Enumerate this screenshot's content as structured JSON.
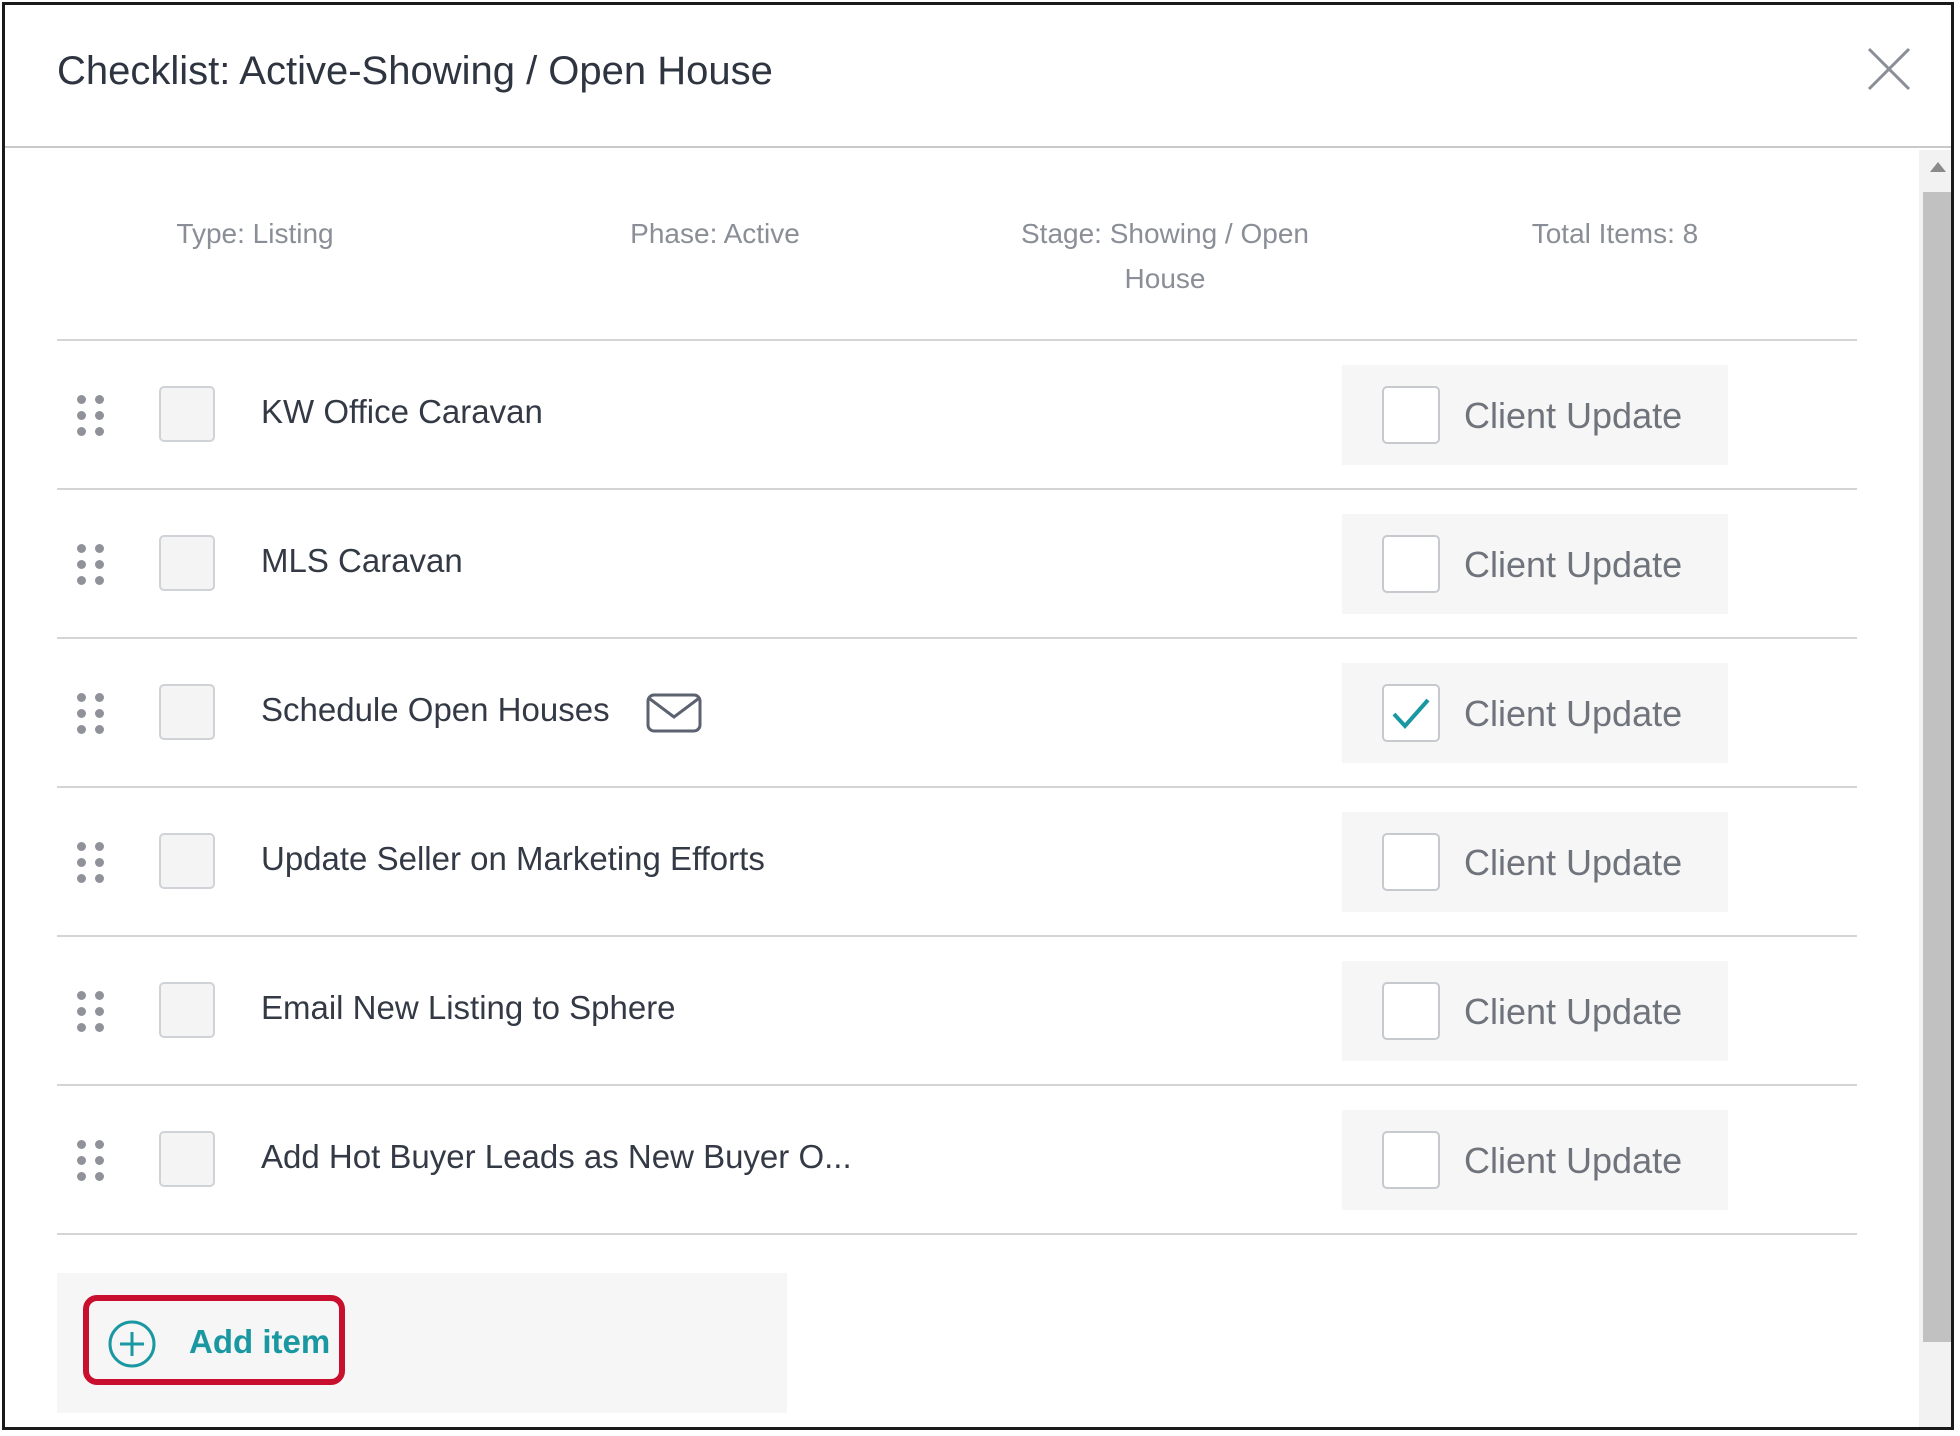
{
  "header": {
    "title": "Checklist: Active-Showing / Open House"
  },
  "meta": {
    "type": "Type: Listing",
    "phase": "Phase: Active",
    "stage": "Stage: Showing / Open House",
    "total": "Total Items: 8"
  },
  "items": [
    {
      "label": "KW Office Caravan",
      "completed": false,
      "has_email": false,
      "client_update_label": "Client Update",
      "client_update_checked": false
    },
    {
      "label": "MLS Caravan",
      "completed": false,
      "has_email": false,
      "client_update_label": "Client Update",
      "client_update_checked": false
    },
    {
      "label": "Schedule Open Houses",
      "completed": false,
      "has_email": true,
      "client_update_label": "Client Update",
      "client_update_checked": true
    },
    {
      "label": "Update Seller on Marketing Efforts",
      "completed": false,
      "has_email": false,
      "client_update_label": "Client Update",
      "client_update_checked": false
    },
    {
      "label": "Email New Listing to Sphere",
      "completed": false,
      "has_email": false,
      "client_update_label": "Client Update",
      "client_update_checked": false
    },
    {
      "label": "Add Hot Buyer Leads as New Buyer O...",
      "completed": false,
      "has_email": false,
      "client_update_label": "Client Update",
      "client_update_checked": false
    }
  ],
  "footer": {
    "add_item_label": "Add item"
  },
  "colors": {
    "accent": "#1a98a2",
    "highlight": "#c8102e"
  },
  "icons": {
    "close": "close-icon",
    "drag": "drag-handle-icon",
    "mail": "mail-icon",
    "check": "checkmark-icon",
    "add": "plus-circle-icon"
  }
}
